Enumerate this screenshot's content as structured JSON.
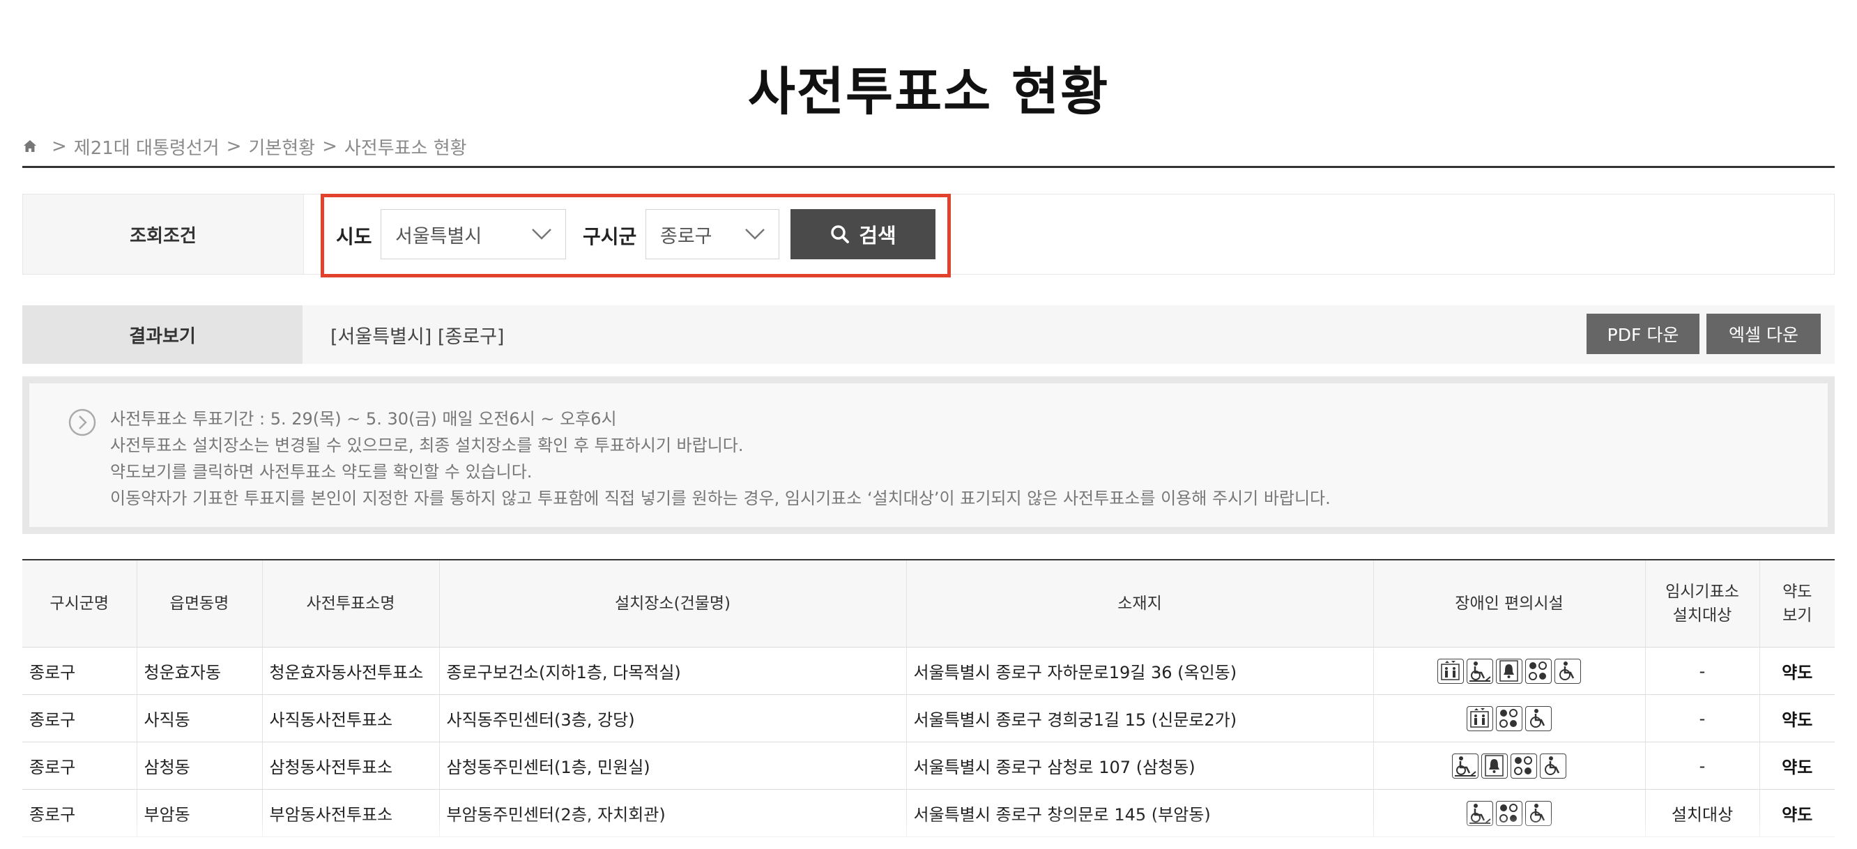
{
  "title": "사전투표소 현황",
  "breadcrumb": {
    "home_icon": "home-icon",
    "items": [
      "제21대 대통령선거",
      "기본현황",
      "사전투표소 현황"
    ],
    "separator": ">"
  },
  "search": {
    "label": "조회조건",
    "sido_label": "시도",
    "sido_value": "서울특별시",
    "sigungu_label": "구시군",
    "sigungu_value": "종로구",
    "button_label": "검색",
    "highlight_color": "#e2412b"
  },
  "result": {
    "label": "결과보기",
    "text": "[서울특별시]  [종로구]",
    "pdf_label": "PDF 다운",
    "excel_label": "엑셀 다운"
  },
  "notice": {
    "lines": [
      "사전투표소 투표기간 : 5. 29(목) ~ 5. 30(금) 매일 오전6시 ~ 오후6시",
      "사전투표소 설치장소는 변경될 수 있으므로, 최종 설치장소를 확인 후 투표하시기 바랍니다.",
      "약도보기를 클릭하면 사전투표소 약도를 확인할 수 있습니다.",
      "이동약자가 기표한 투표지를 본인이 지정한 자를 통하지 않고 투표함에 직접 넣기를 원하는 경우, 임시기표소 ‘설치대상’이 표기되지 않은 사전투표소를 이용해 주시기 바랍니다."
    ]
  },
  "table": {
    "headers": [
      "구시군명",
      "읍면동명",
      "사전투표소명",
      "설치장소(건물명)",
      "소재지",
      "장애인 편의시설",
      "임시기표소\n설치대상",
      "약도\n보기"
    ],
    "rows": [
      {
        "gu": "종로구",
        "dong": "청운효자동",
        "name": "청운효자동사전투표소",
        "place": "종로구보건소(지하1층, 다목적실)",
        "addr": "서울특별시 종로구 자하문로19길 36 (옥인동)",
        "facilities": [
          "elevator-icon",
          "wheelchair-ramp-icon",
          "bell-icon",
          "braille-icon",
          "wheelchair-icon"
        ],
        "temp": "-",
        "map": "약도"
      },
      {
        "gu": "종로구",
        "dong": "사직동",
        "name": "사직동사전투표소",
        "place": "사직동주민센터(3층, 강당)",
        "addr": "서울특별시 종로구 경희궁1길 15 (신문로2가)",
        "facilities": [
          "elevator-icon",
          "braille-icon",
          "wheelchair-icon"
        ],
        "temp": "-",
        "map": "약도"
      },
      {
        "gu": "종로구",
        "dong": "삼청동",
        "name": "삼청동사전투표소",
        "place": "삼청동주민센터(1층, 민원실)",
        "addr": "서울특별시 종로구 삼청로 107 (삼청동)",
        "facilities": [
          "wheelchair-ramp-icon",
          "bell-icon",
          "braille-icon",
          "wheelchair-icon"
        ],
        "temp": "-",
        "map": "약도"
      },
      {
        "gu": "종로구",
        "dong": "부암동",
        "name": "부암동사전투표소",
        "place": "부암동주민센터(2층, 자치회관)",
        "addr": "서울특별시 종로구 창의문로 145 (부암동)",
        "facilities": [
          "wheelchair-ramp-icon",
          "braille-icon",
          "wheelchair-icon"
        ],
        "temp": "설치대상",
        "map": "약도"
      }
    ]
  }
}
